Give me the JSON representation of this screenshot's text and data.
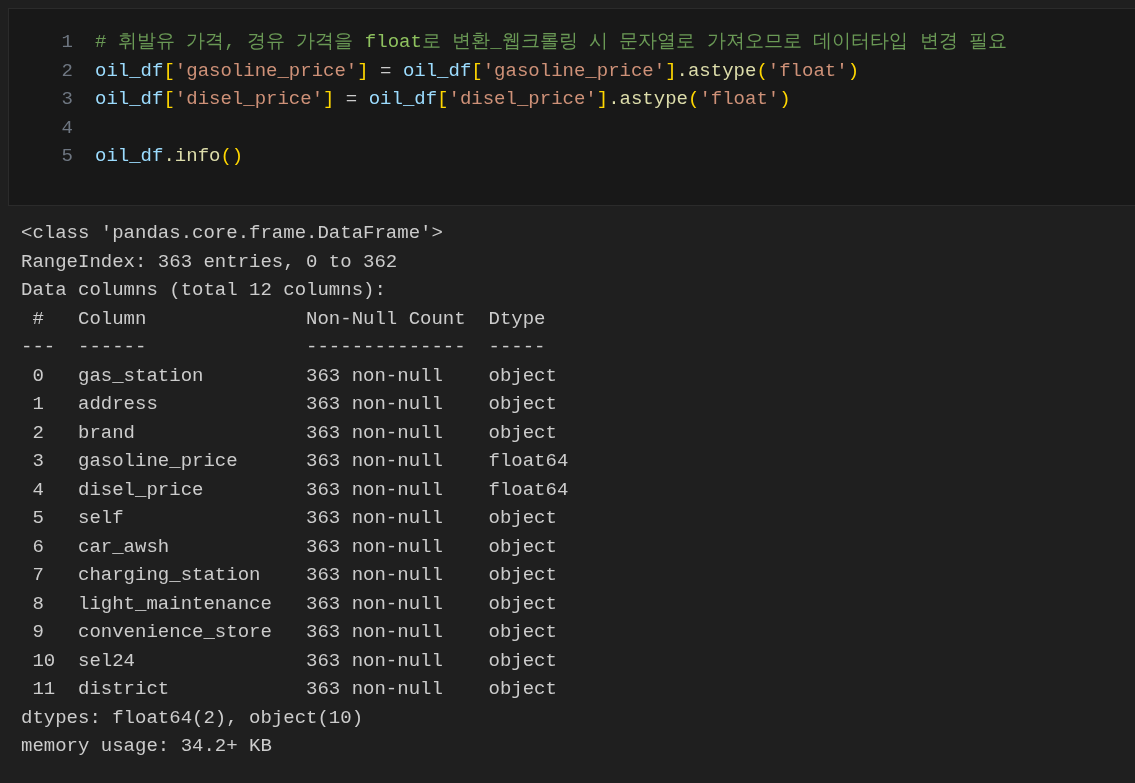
{
  "code_cell": {
    "lines": [
      {
        "number": "1",
        "tokens": [
          {
            "kind": "comment",
            "text": "# 휘발유 가격, 경유 가격을 "
          },
          {
            "kind": "comment-strong",
            "text": "float"
          },
          {
            "kind": "comment",
            "text": "로 변환_웹크롤링 시 문자열로 가져오므로 데이터타입 변경 필요"
          }
        ]
      },
      {
        "number": "2",
        "tokens": [
          {
            "kind": "var",
            "text": "oil_df"
          },
          {
            "kind": "bracket",
            "text": "["
          },
          {
            "kind": "string",
            "text": "'gasoline_price'"
          },
          {
            "kind": "bracket",
            "text": "]"
          },
          {
            "kind": "plain",
            "text": " = "
          },
          {
            "kind": "var",
            "text": "oil_df"
          },
          {
            "kind": "bracket",
            "text": "["
          },
          {
            "kind": "string",
            "text": "'gasoline_price'"
          },
          {
            "kind": "bracket",
            "text": "]"
          },
          {
            "kind": "method",
            "text": ".astype"
          },
          {
            "kind": "bracket",
            "text": "("
          },
          {
            "kind": "string",
            "text": "'float'"
          },
          {
            "kind": "bracket",
            "text": ")"
          }
        ]
      },
      {
        "number": "3",
        "tokens": [
          {
            "kind": "var",
            "text": "oil_df"
          },
          {
            "kind": "bracket",
            "text": "["
          },
          {
            "kind": "string",
            "text": "'disel_price'"
          },
          {
            "kind": "bracket",
            "text": "]"
          },
          {
            "kind": "plain",
            "text": " = "
          },
          {
            "kind": "var",
            "text": "oil_df"
          },
          {
            "kind": "bracket",
            "text": "["
          },
          {
            "kind": "string",
            "text": "'disel_price'"
          },
          {
            "kind": "bracket",
            "text": "]"
          },
          {
            "kind": "method",
            "text": ".astype"
          },
          {
            "kind": "bracket",
            "text": "("
          },
          {
            "kind": "string",
            "text": "'float'"
          },
          {
            "kind": "bracket",
            "text": ")"
          }
        ]
      },
      {
        "number": "4"
      },
      {
        "number": "5",
        "tokens": [
          {
            "kind": "var",
            "text": "oil_df"
          },
          {
            "kind": "method",
            "text": ".info"
          },
          {
            "kind": "bracket",
            "text": "()"
          }
        ]
      }
    ]
  },
  "output": {
    "lines": [
      "<class 'pandas.core.frame.DataFrame'>",
      "RangeIndex: 363 entries, 0 to 362",
      "Data columns (total 12 columns):",
      " #   Column              Non-Null Count  Dtype  ",
      "---  ------              --------------  -----  ",
      " 0   gas_station         363 non-null    object ",
      " 1   address             363 non-null    object ",
      " 2   brand               363 non-null    object ",
      " 3   gasoline_price      363 non-null    float64",
      " 4   disel_price         363 non-null    float64",
      " 5   self                363 non-null    object ",
      " 6   car_awsh            363 non-null    object ",
      " 7   charging_station    363 non-null    object ",
      " 8   light_maintenance   363 non-null    object ",
      " 9   convenience_store   363 non-null    object ",
      " 10  sel24               363 non-null    object ",
      " 11  district            363 non-null    object ",
      "dtypes: float64(2), object(10)",
      "memory usage: 34.2+ KB"
    ]
  }
}
